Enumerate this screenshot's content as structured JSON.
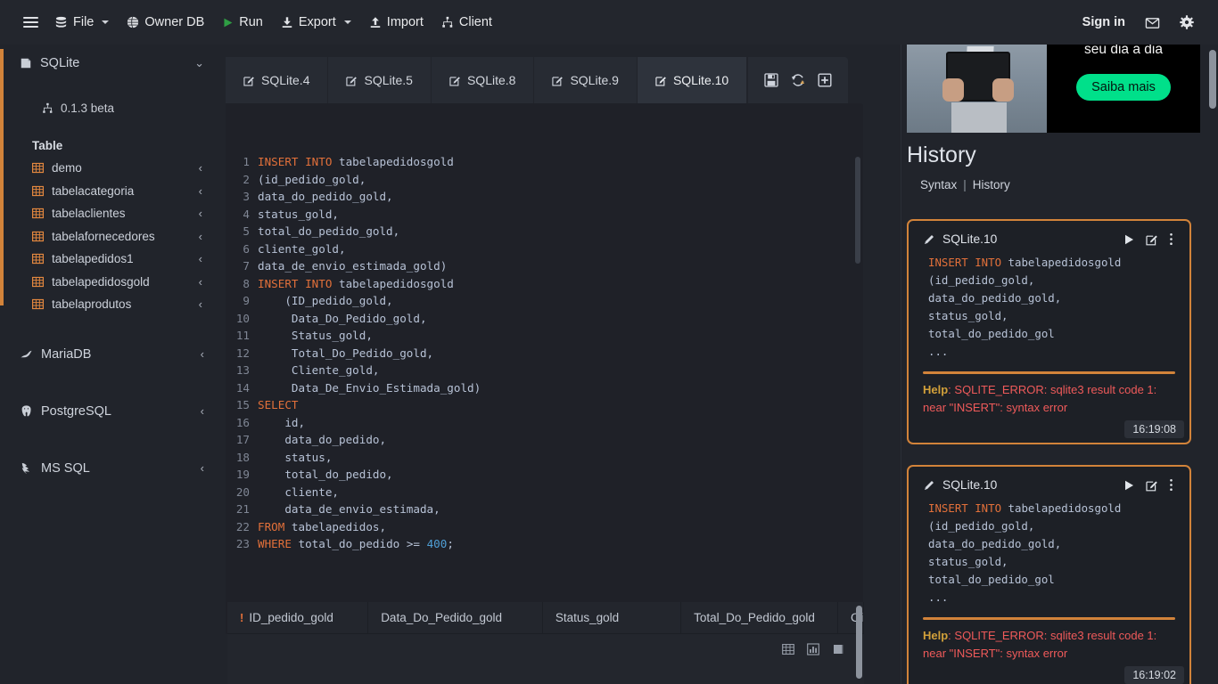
{
  "topbar": {
    "menu_icon": "hamburger-icon",
    "items": [
      {
        "label": "File",
        "icon": "database-icon",
        "has_caret": true
      },
      {
        "label": "Owner DB",
        "icon": "globe-icon",
        "has_caret": false
      },
      {
        "label": "Run",
        "icon": "play-icon",
        "has_caret": false
      },
      {
        "label": "Export",
        "icon": "download-icon",
        "has_caret": true
      },
      {
        "label": "Import",
        "icon": "upload-icon",
        "has_caret": false
      },
      {
        "label": "Client",
        "icon": "network-icon",
        "has_caret": false
      }
    ],
    "sign_in": "Sign in",
    "mail_icon": "envelope-icon",
    "settings_icon": "gear-icon"
  },
  "sidebar": {
    "accent_color": "#d2833a",
    "groups": [
      {
        "name": "SQLite",
        "icon": "sqlite-icon",
        "chevron": "chevron-down-icon",
        "expanded": true,
        "version": "0.1.3 beta",
        "version_icon": "network-icon",
        "section_label": "Table",
        "tables": [
          "demo",
          "tabelacategoria",
          "tabelaclientes",
          "tabelafornecedores",
          "tabelapedidos1",
          "tabelapedidosgold",
          "tabelaprodutos"
        ]
      },
      {
        "name": "MariaDB",
        "icon": "mariadb-icon",
        "chevron": "chevron-left-icon",
        "expanded": false
      },
      {
        "name": "PostgreSQL",
        "icon": "postgres-icon",
        "chevron": "chevron-left-icon",
        "expanded": false
      },
      {
        "name": "MS SQL",
        "icon": "mssql-icon",
        "chevron": "chevron-left-icon",
        "expanded": false
      }
    ]
  },
  "tabs": {
    "items": [
      {
        "label": "SQLite.4",
        "active": false
      },
      {
        "label": "SQLite.5",
        "active": false
      },
      {
        "label": "SQLite.8",
        "active": false
      },
      {
        "label": "SQLite.9",
        "active": false
      },
      {
        "label": "SQLite.10",
        "active": true
      }
    ],
    "actions": [
      {
        "name": "save-icon"
      },
      {
        "name": "refresh-icon"
      },
      {
        "name": "add-tab-icon"
      }
    ]
  },
  "editor": {
    "lines": [
      {
        "n": 1,
        "text": "INSERT INTO tabelapedidosgold",
        "kw": "INSERT INTO"
      },
      {
        "n": 2,
        "text": "(id_pedido_gold,",
        "kw": ""
      },
      {
        "n": 3,
        "text": "data_do_pedido_gold,",
        "kw": ""
      },
      {
        "n": 4,
        "text": "status_gold,",
        "kw": ""
      },
      {
        "n": 5,
        "text": "total_do_pedido_gold,",
        "kw": ""
      },
      {
        "n": 6,
        "text": "cliente_gold,",
        "kw": ""
      },
      {
        "n": 7,
        "text": "data_de_envio_estimada_gold)",
        "kw": ""
      },
      {
        "n": 8,
        "text": "INSERT INTO tabelapedidosgold",
        "kw": "INSERT INTO"
      },
      {
        "n": 9,
        "text": "    (ID_pedido_gold,",
        "kw": ""
      },
      {
        "n": 10,
        "text": "     Data_Do_Pedido_gold,",
        "kw": ""
      },
      {
        "n": 11,
        "text": "     Status_gold,",
        "kw": ""
      },
      {
        "n": 12,
        "text": "     Total_Do_Pedido_gold,",
        "kw": ""
      },
      {
        "n": 13,
        "text": "     Cliente_gold,",
        "kw": ""
      },
      {
        "n": 14,
        "text": "     Data_De_Envio_Estimada_gold)",
        "kw": ""
      },
      {
        "n": 15,
        "text": "SELECT",
        "kw": "SELECT"
      },
      {
        "n": 16,
        "text": "    id,",
        "kw": ""
      },
      {
        "n": 17,
        "text": "    data_do_pedido,",
        "kw": ""
      },
      {
        "n": 18,
        "text": "    status,",
        "kw": ""
      },
      {
        "n": 19,
        "text": "    total_do_pedido,",
        "kw": ""
      },
      {
        "n": 20,
        "text": "    cliente,",
        "kw": ""
      },
      {
        "n": 21,
        "text": "    data_de_envio_estimada,",
        "kw": ""
      },
      {
        "n": 22,
        "text": "FROM tabelapedidos,",
        "kw": "FROM"
      },
      {
        "n": 23,
        "text": "WHERE total_do_pedido >= 400;",
        "kw": "WHERE",
        "numlit": "400"
      }
    ]
  },
  "results": {
    "columns": [
      {
        "label": "ID_pedido_gold",
        "flag": "!"
      },
      {
        "label": "Data_Do_Pedido_gold",
        "flag": ""
      },
      {
        "label": "Status_gold",
        "flag": ""
      },
      {
        "label": "Total_Do_Pedido_gold",
        "flag": ""
      },
      {
        "label": "Cli",
        "flag": ""
      }
    ],
    "tools": [
      {
        "name": "grid-view-icon"
      },
      {
        "name": "chart-view-icon"
      },
      {
        "name": "book-view-icon"
      }
    ]
  },
  "right": {
    "ad": {
      "headline": "seu dia a dia",
      "cta": "Saiba mais",
      "cta_color": "#00e08a"
    },
    "title": "History",
    "links": {
      "syntax": "Syntax",
      "separator": "|",
      "history": "History"
    },
    "accent_color": "#d2833a",
    "cards": [
      {
        "title": "SQLite.10",
        "pencil_icon": "pencil-icon",
        "run_icon": "play-icon",
        "edit_icon": "edit-icon",
        "more_icon": "more-vertical-icon",
        "code": "INSERT INTO tabelapedidosgold\n(id_pedido_gold,\ndata_do_pedido_gold,\nstatus_gold,\ntotal_do_pedido_gol\n...",
        "code_keyword": "INSERT INTO",
        "help_label": "Help",
        "help_text": ": SQLITE_ERROR: sqlite3 result code 1: near \"INSERT\": syntax error",
        "time": "16:19:08"
      },
      {
        "title": "SQLite.10",
        "pencil_icon": "pencil-icon",
        "run_icon": "play-icon",
        "edit_icon": "edit-icon",
        "more_icon": "more-vertical-icon",
        "code": "INSERT INTO tabelapedidosgold\n(id_pedido_gold,\ndata_do_pedido_gold,\nstatus_gold,\ntotal_do_pedido_gol\n...",
        "code_keyword": "INSERT INTO",
        "help_label": "Help",
        "help_text": ": SQLITE_ERROR: sqlite3 result code 1: near \"INSERT\": syntax error",
        "time": "16:19:02"
      }
    ]
  }
}
